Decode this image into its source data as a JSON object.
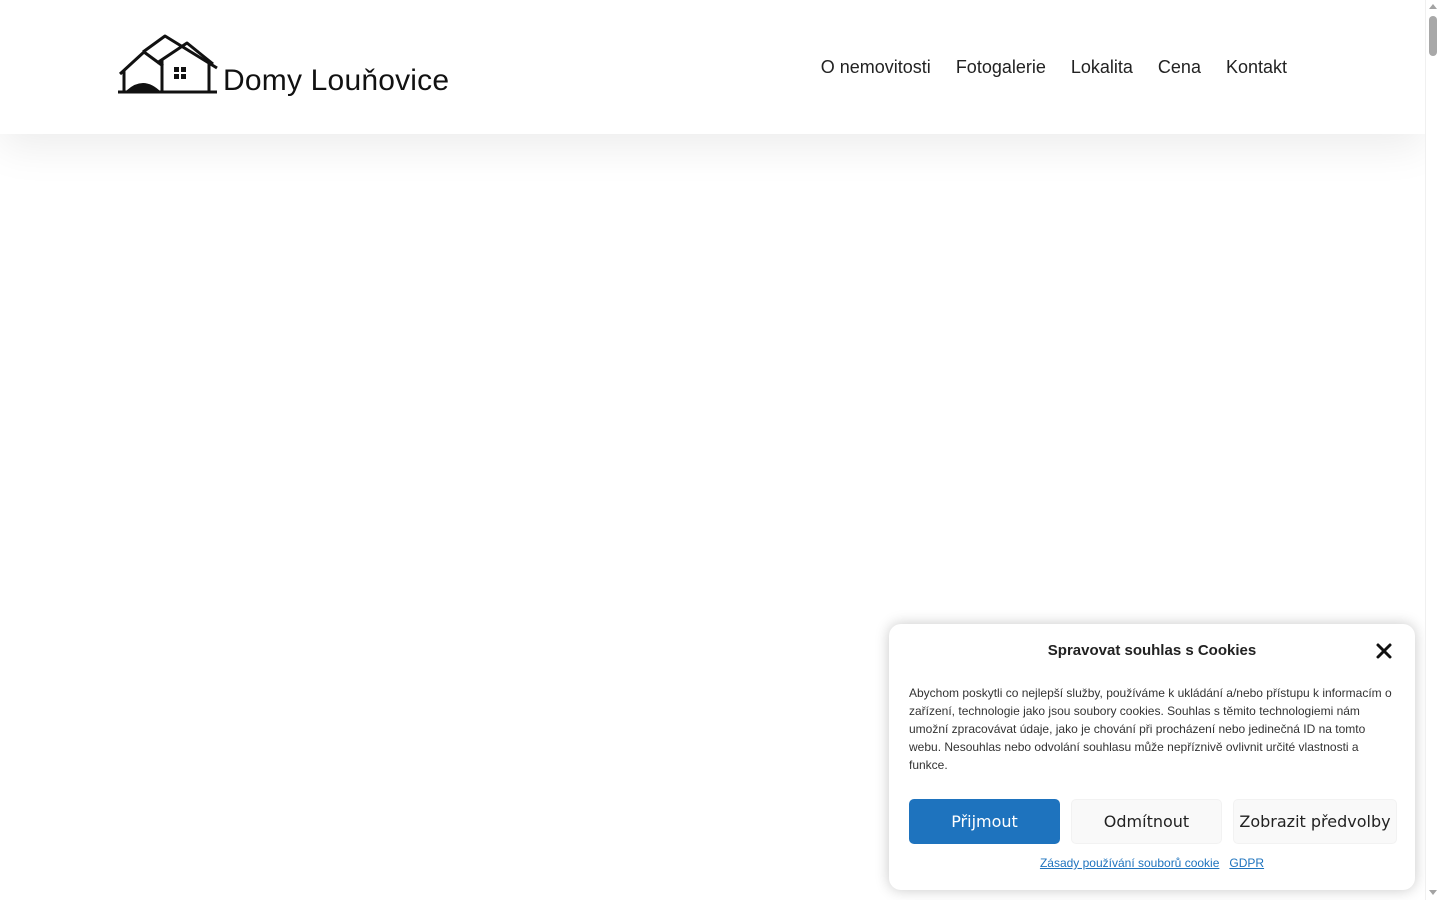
{
  "header": {
    "brand_name": "Domy Louňovice",
    "nav": [
      {
        "label": "O nemovitosti"
      },
      {
        "label": "Fotogalerie"
      },
      {
        "label": "Lokalita"
      },
      {
        "label": "Cena"
      },
      {
        "label": "Kontakt"
      }
    ]
  },
  "cookie_banner": {
    "title": "Spravovat souhlas s Cookies",
    "text": "Abychom poskytli co nejlepší služby, používáme k ukládání a/nebo přístupu k informacím o zařízení, technologie jako jsou soubory cookies. Souhlas s těmito technologiemi nám umožní zpracovávat údaje, jako je chování při procházení nebo jedinečná ID na tomto webu. Nesouhlas nebo odvolání souhlasu může nepříznivě ovlivnit určité vlastnosti a funkce.",
    "accept_label": "Přijmout",
    "deny_label": "Odmítnout",
    "preferences_label": "Zobrazit předvolby",
    "links": [
      {
        "label": "Zásady používání souborů cookie"
      },
      {
        "label": "GDPR"
      }
    ]
  },
  "icons": {
    "logo": "house-logo-icon",
    "close": "close-icon"
  },
  "colors": {
    "accent": "#1e73be"
  }
}
